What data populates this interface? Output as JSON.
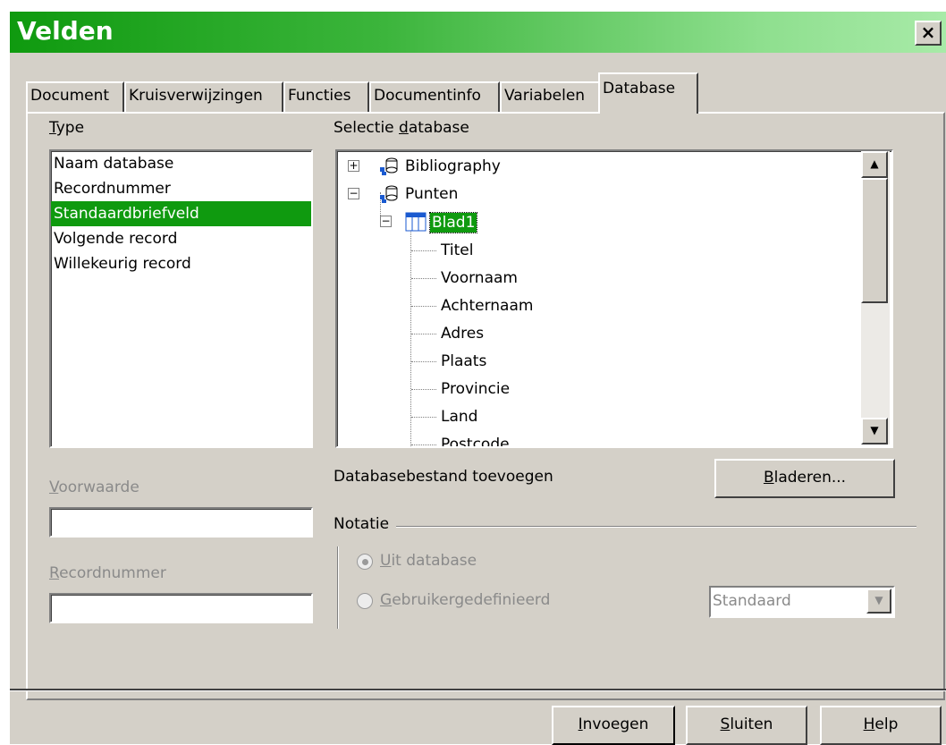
{
  "window": {
    "title": "Velden",
    "close_label": "×"
  },
  "tabs": [
    {
      "label": "Document"
    },
    {
      "label": "Kruisverwijzingen"
    },
    {
      "label": "Functies"
    },
    {
      "label": "Documentinfo"
    },
    {
      "label": "Variabelen"
    },
    {
      "label": "Database",
      "active": true
    }
  ],
  "type_section": {
    "label_first": "T",
    "label_rest": "ype",
    "items": [
      "Naam database",
      "Recordnummer",
      "Standaardbriefveld",
      "Volgende record",
      "Willekeurig record"
    ],
    "selected": "Standaardbriefveld"
  },
  "selection": {
    "label_pre": "Selectie ",
    "label_u": "d",
    "label_post": "atabase",
    "tree": {
      "db1": "Bibliography",
      "db2": "Punten",
      "table": "Blad1",
      "fields": [
        "Titel",
        "Voornaam",
        "Achternaam",
        "Adres",
        "Plaats",
        "Provincie",
        "Land",
        "Postcode"
      ]
    }
  },
  "condition": {
    "label_u": "V",
    "label_rest": "oorwaarde",
    "value": ""
  },
  "recordnumber": {
    "label_u": "R",
    "label_rest": "ecordnummer",
    "value": ""
  },
  "add_db": {
    "label": "Databasebestand toevoegen",
    "browse_u": "B",
    "browse_rest": "laderen..."
  },
  "notation": {
    "label": "Notatie",
    "option1_u": "U",
    "option1_rest": "it database",
    "option2_u": "G",
    "option2_rest": "ebruikergedefinieerd",
    "selected": "Uit database",
    "format_value": "Standaard"
  },
  "buttons": {
    "insert_u": "I",
    "insert_rest": "nvoegen",
    "close_u": "S",
    "close_rest": "luiten",
    "help_u": "H",
    "help_rest": "elp"
  },
  "colors": {
    "title_gradient_start": "#0f9a0f",
    "selection": "#0f9a0f",
    "dialog_bg": "#d4d0c8"
  }
}
